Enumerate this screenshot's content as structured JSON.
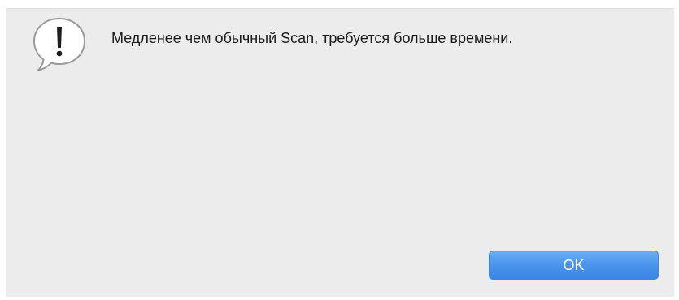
{
  "dialog": {
    "message": "Медленее чем обычный Scan, требуется больше времени.",
    "icon": "exclamation-speech-bubble-icon",
    "ok_label": "OK"
  },
  "colors": {
    "background": "#ececec",
    "button_blue": "#4a94ec",
    "button_text": "#ffffff"
  }
}
